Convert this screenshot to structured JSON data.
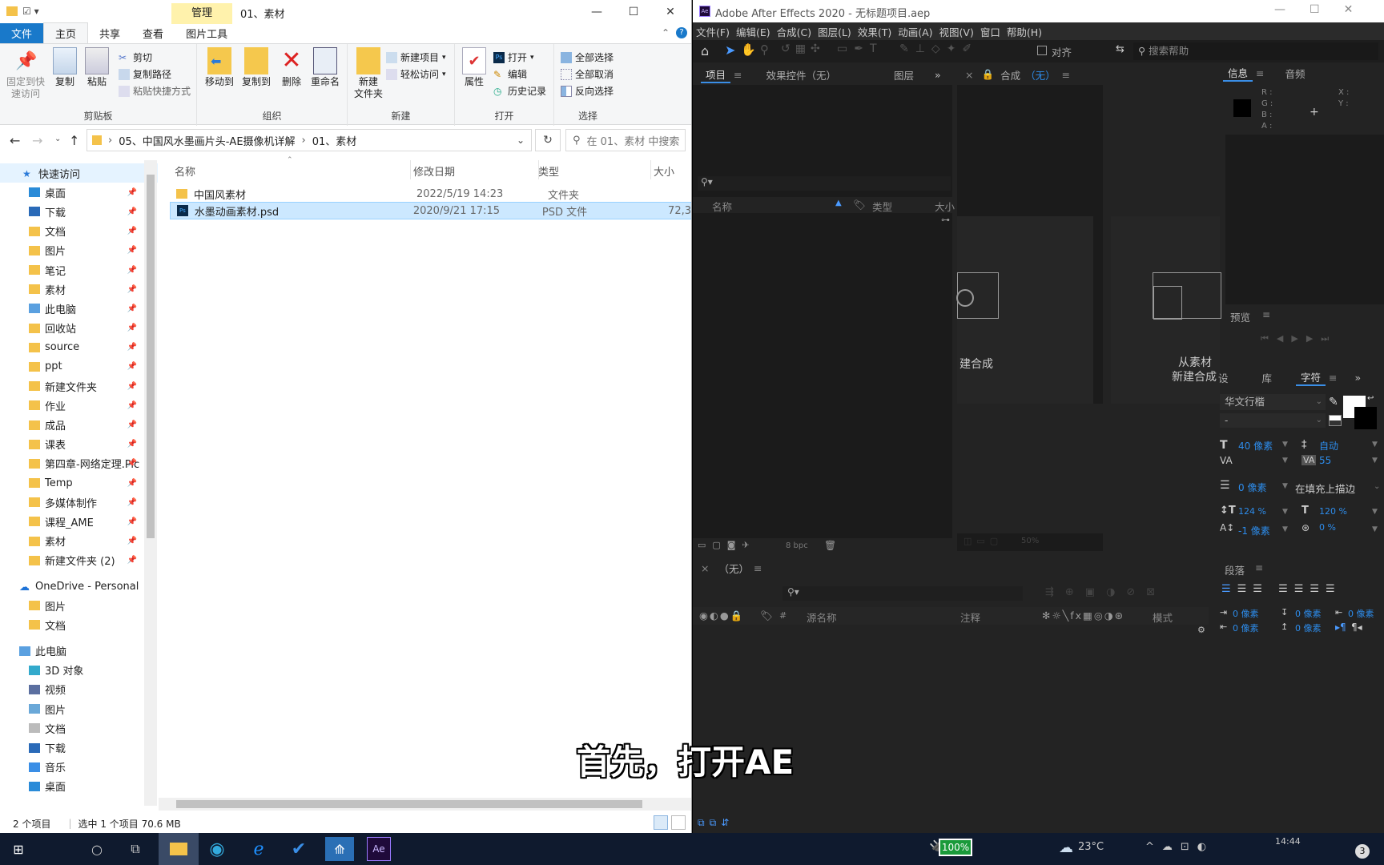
{
  "explorer": {
    "quick_icons": "☑ ▾",
    "manage_tab": "管理",
    "window_title": "01、素材",
    "tabs": [
      "文件",
      "主页",
      "共享",
      "查看",
      "图片工具"
    ],
    "ribbon": {
      "clipboard": {
        "label": "剪贴板",
        "pin": "固定到快速访问",
        "copy": "复制",
        "paste": "粘贴",
        "cut": "剪切",
        "copy_path": "复制路径",
        "paste_shortcut": "粘贴快捷方式"
      },
      "organize": {
        "label": "组织",
        "move_to": "移动到",
        "copy_to": "复制到",
        "delete": "删除",
        "rename": "重命名"
      },
      "new": {
        "label": "新建",
        "new_folder": "新建\n文件夹",
        "new_item": "新建项目",
        "easy_access": "轻松访问"
      },
      "open": {
        "label": "打开",
        "properties": "属性",
        "open": "打开",
        "edit": "编辑",
        "history": "历史记录"
      },
      "select": {
        "label": "选择",
        "select_all": "全部选择",
        "select_none": "全部取消",
        "invert": "反向选择"
      }
    },
    "address": {
      "path1": "05、中国风水墨画片头-AE摄像机详解",
      "sep": "›",
      "path2": "01、素材",
      "search_placeholder": "在 01、素材 中搜索"
    },
    "nav": {
      "quick_access": "快速访问",
      "quick_items": [
        "桌面",
        "下载",
        "文档",
        "图片",
        "笔记",
        "素材",
        "此电脑",
        "回收站",
        "source",
        "ppt",
        "新建文件夹",
        "作业",
        "成品",
        "课表",
        "第四章-网络定理.Pic",
        "Temp",
        "多媒体制作",
        "课程_AME",
        "素材",
        "新建文件夹 (2)"
      ],
      "onedrive": "OneDrive - Personal",
      "onedrive_items": [
        "图片",
        "文档"
      ],
      "this_pc": "此电脑",
      "pc_items": [
        "3D 对象",
        "视频",
        "图片",
        "文档",
        "下载",
        "音乐",
        "桌面"
      ]
    },
    "columns": {
      "name": "名称",
      "modified": "修改日期",
      "type": "类型",
      "size": "大小"
    },
    "files": [
      {
        "name": "中国风素材",
        "modified": "2022/5/19 14:23",
        "type": "文件夹",
        "size": ""
      },
      {
        "name": "水墨动画素材.psd",
        "modified": "2020/9/21 17:15",
        "type": "PSD 文件",
        "size": "72,3"
      }
    ],
    "status": {
      "count": "2 个项目",
      "selected": "选中 1 个项目  70.6 MB"
    }
  },
  "ae": {
    "title": "Adobe After Effects 2020 - 无标题项目.aep",
    "menu": [
      "文件(F)",
      "编辑(E)",
      "合成(C)",
      "图层(L)",
      "效果(T)",
      "动画(A)",
      "视图(V)",
      "窗口",
      "帮助(H)"
    ],
    "align_label": "对齐",
    "search_help": "搜索帮助",
    "project_tabs": [
      "项目",
      "效果控件（无）",
      "图层"
    ],
    "project_cols": {
      "name": "名称",
      "type": "类型",
      "size": "大小"
    },
    "bpc": "8 bpc",
    "comp_tab": "合成",
    "comp_none": "（无）",
    "new_comp": "建合成",
    "from_footage_1": "从素材",
    "from_footage_2": "新建合成",
    "zoom": "50%",
    "info_tabs": [
      "信息",
      "音频"
    ],
    "info_rgb": [
      "R :",
      "G :",
      "B :",
      "A :"
    ],
    "info_xy": [
      "X :",
      "Y :"
    ],
    "preview": "预览",
    "char_tabs": [
      "设",
      "库",
      "字符"
    ],
    "char": {
      "font": "华文行楷",
      "style": "-",
      "size": "40 像素",
      "leading": "自动",
      "kerning": "",
      "tracking": "55",
      "stroke": "0 像素",
      "stroke_mode": "在填充上描边",
      "vscale": "124 %",
      "hscale": "120 %",
      "baseline": "-1 像素",
      "tsume": "0 %"
    },
    "paragraph": "段落",
    "para_vals": [
      "0 像素",
      "0 像素",
      "0 像素",
      "0 像素",
      "0 像素"
    ],
    "timeline_tab": "（无）",
    "timeline_cols": {
      "hash": "#",
      "source": "源名称",
      "comment": "注释",
      "mode": "模式"
    }
  },
  "subtitle": "首先，打开AE",
  "taskbar": {
    "battery": "100%",
    "temp": "23°C",
    "time": "14:44",
    "badge": "3"
  }
}
